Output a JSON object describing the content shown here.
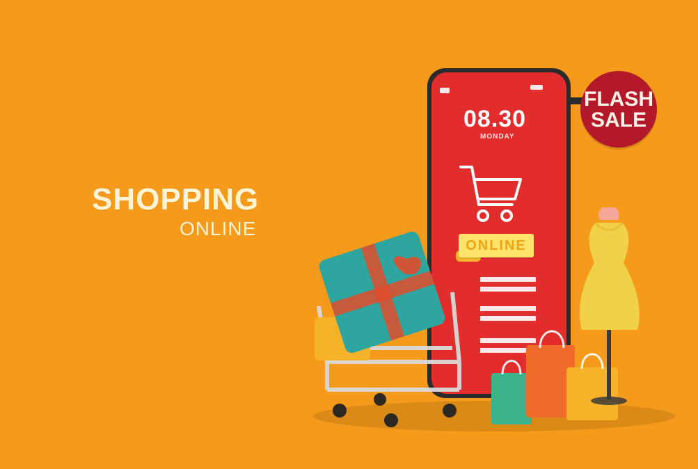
{
  "hero": {
    "title": "SHOPPING",
    "subtitle": "ONLINE"
  },
  "phone": {
    "time": "08.30",
    "day": "MONDAY",
    "online_tag": "ONLINE"
  },
  "badge": {
    "line1": "FLASH",
    "line2": "SALE"
  },
  "colors": {
    "background": "#F59A1A",
    "phone_red": "#E32D2D",
    "badge_red": "#B3192A",
    "tag_yellow": "#FFE36A",
    "gift_teal": "#2FA5A0",
    "bag_green": "#3DB38B",
    "bag_orange": "#F06A2A",
    "dress_yellow": "#F2D14A"
  },
  "icons": {
    "cart_screen": "shopping-cart-icon",
    "lightning": "lightning-bolt-icon",
    "cart": "shopping-cart",
    "gift": "gift-box",
    "bags": "shopping-bags",
    "dress": "mannequin-dress"
  }
}
